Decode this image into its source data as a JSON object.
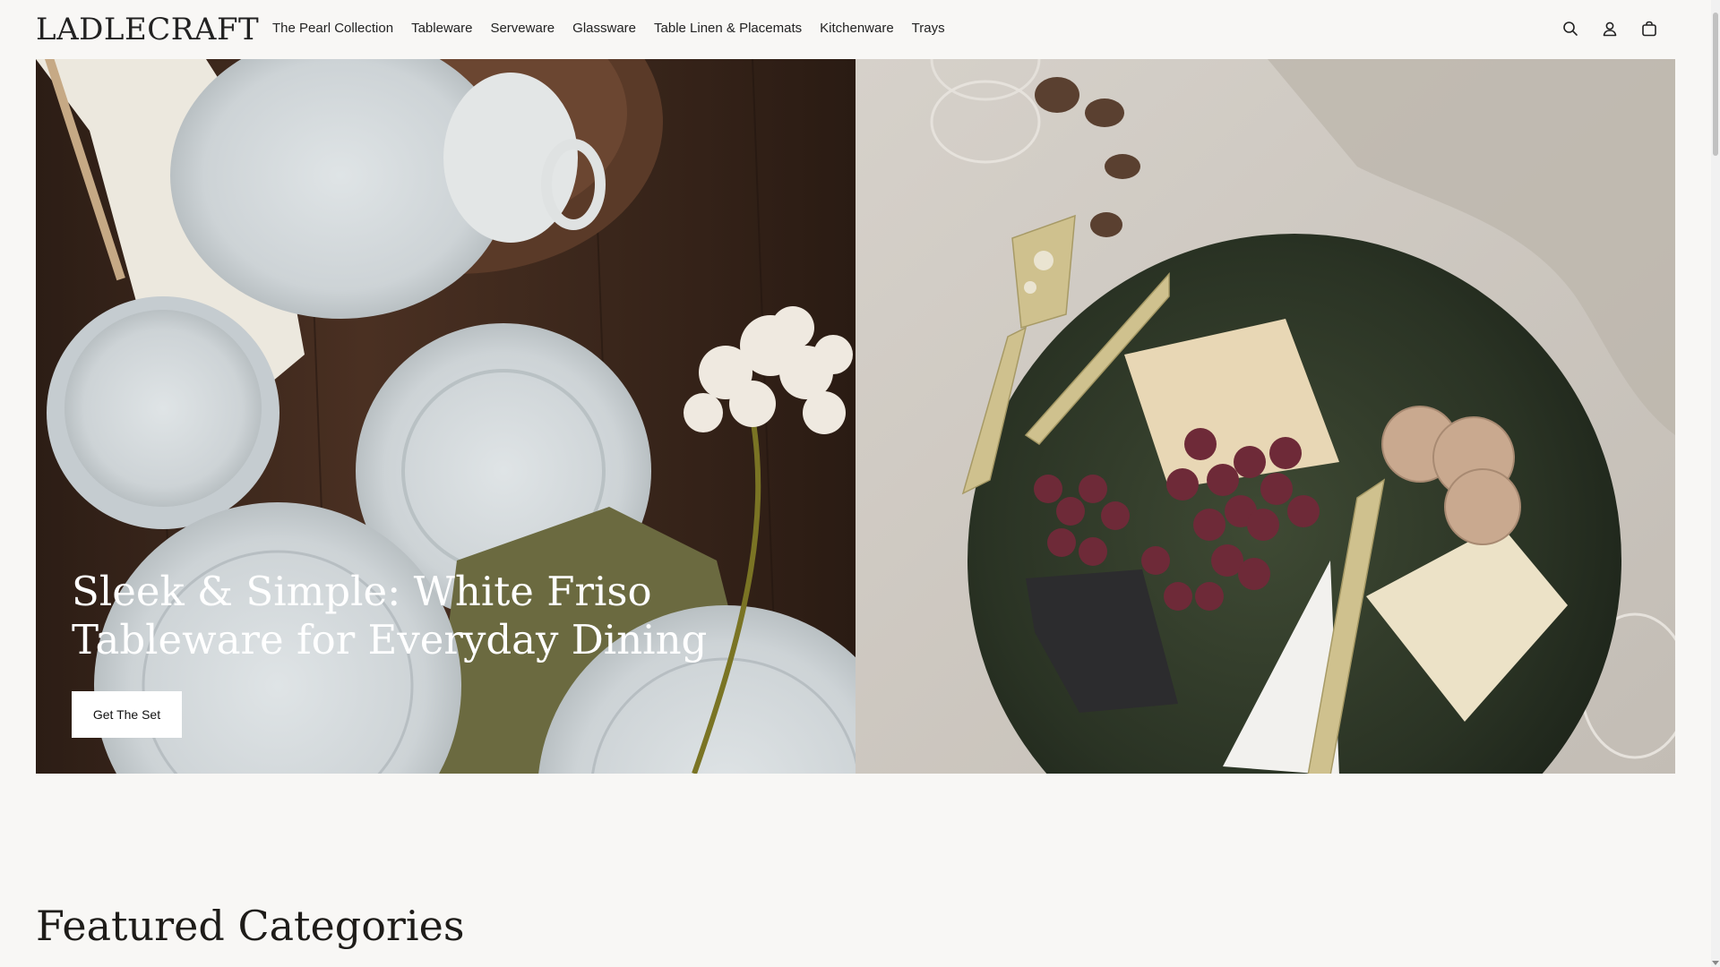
{
  "brand": {
    "logo_text": "LADLECRAFT"
  },
  "nav": {
    "items": [
      {
        "label": "The Pearl Collection"
      },
      {
        "label": "Tableware"
      },
      {
        "label": "Serveware"
      },
      {
        "label": "Glassware"
      },
      {
        "label": "Table Linen & Placemats"
      },
      {
        "label": "Kitchenware"
      },
      {
        "label": "Trays"
      }
    ]
  },
  "header_icons": [
    "search-icon",
    "account-icon",
    "bag-icon"
  ],
  "hero": {
    "heading": "Sleek & Simple: White Friso Tableware for Everyday Dining",
    "cta_label": "Get The Set",
    "left_image": "white-plates-tableware-photo",
    "right_image": "cheese-board-platter-photo"
  },
  "featured": {
    "title": "Featured Categories"
  },
  "colors": {
    "background": "#f8f7f5",
    "text": "#1f1d1a",
    "button_bg": "#ffffff",
    "wood_dark": "#3d2a1f",
    "linen": "#cfcac3",
    "marble": "#2f3a2c"
  }
}
